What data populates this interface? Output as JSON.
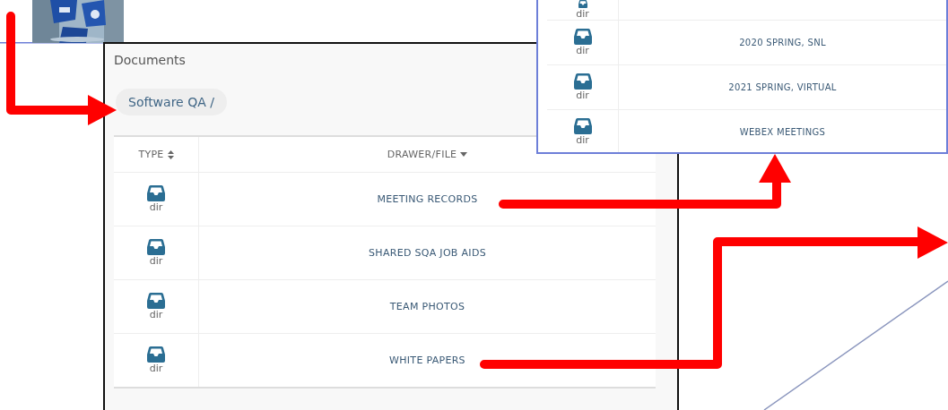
{
  "documents": {
    "title": "Documents",
    "breadcrumb": "Software QA /",
    "columns": [
      {
        "label": "TYPE",
        "sorted": false
      },
      {
        "label": "DRAWER/FILE",
        "sorted": true
      }
    ],
    "rows": [
      {
        "type": "dir",
        "name": "MEETING RECORDS"
      },
      {
        "type": "dir",
        "name": "SHARED SQA JOB AIDS"
      },
      {
        "type": "dir",
        "name": "TEAM PHOTOS"
      },
      {
        "type": "dir",
        "name": "WHITE PAPERS"
      }
    ]
  },
  "meeting_records": {
    "rows": [
      {
        "type": "dir"
      },
      {
        "type": "dir",
        "name": "2020 SPRING, SNL"
      },
      {
        "type": "dir",
        "name": "2021 SPRING, VIRTUAL"
      },
      {
        "type": "dir",
        "name": "WEBEX MEETINGS"
      }
    ]
  }
}
